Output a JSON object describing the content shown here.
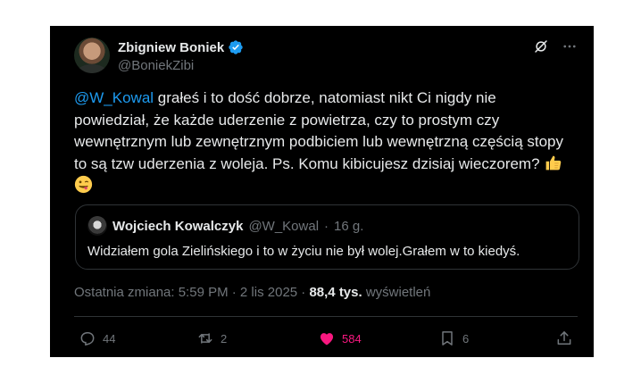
{
  "author": {
    "name": "Zbigniew Boniek",
    "handle": "@BoniekZibi"
  },
  "post": {
    "mention": "@W_Kowal",
    "text": " grałeś i to dość dobrze, natomiast nikt Ci nigdy nie powiedział,  że każde uderzenie z powietrza, czy to prostym czy wewnętrznym lub zewnętrznym podbiciem lub wewnętrzną częścią stopy to są tzw uderzenia z woleja. Ps. Komu kibicujesz dzisiaj wieczorem? ",
    "emoji_icons": [
      "thumbs-up-icon",
      "winking-tongue-face-icon"
    ]
  },
  "quote": {
    "name": "Wojciech Kowalczyk",
    "handle": "@W_Kowal",
    "separator": "·",
    "time": "16 g.",
    "text": "Widziałem gola Zielińskiego i to w życiu nie był wolej.Grałem w to kiedyś."
  },
  "meta": {
    "edited": "Ostatnia zmiana: 5:59 PM · 2 lis 2025 · ",
    "views_count": "88,4 tys.",
    "views_label": " wyświetleń"
  },
  "actions": {
    "replies": "44",
    "reposts": "2",
    "likes": "584",
    "bookmarks": "6"
  },
  "colors": {
    "background": "#000000",
    "text": "#e7e9ea",
    "muted": "#71767b",
    "accent": "#1d9bf0",
    "like": "#f91880",
    "border": "#2f3336"
  }
}
